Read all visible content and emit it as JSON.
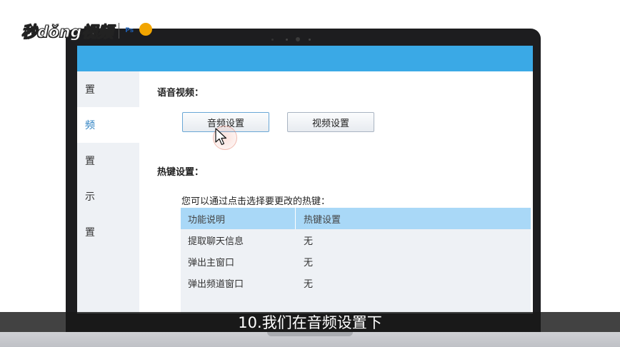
{
  "brand": {
    "logo_text": "秒dǒng视频",
    "partner_text": "Ps"
  },
  "sidebar": {
    "items": [
      {
        "label": "置"
      },
      {
        "label": "频"
      },
      {
        "label": "置"
      },
      {
        "label": "示"
      },
      {
        "label": "置"
      }
    ],
    "active_index": 1
  },
  "voice_video": {
    "title": "语音视频：",
    "audio_button": "音频设置",
    "video_button": "视频设置"
  },
  "hotkeys": {
    "title": "热键设置：",
    "hint": "您可以通过点击选择要更改的热键：",
    "columns": [
      "功能说明",
      "热键设置"
    ],
    "rows": [
      {
        "func": "提取聊天信息",
        "key": "无"
      },
      {
        "func": "弹出主窗口",
        "key": "无"
      },
      {
        "func": "弹出频道窗口",
        "key": "无"
      }
    ]
  },
  "subtitle": "10.我们在音频设置下",
  "colors": {
    "topbar": "#3aa9e6",
    "table_header": "#a9d8f7",
    "accent": "#2a7fc1"
  }
}
